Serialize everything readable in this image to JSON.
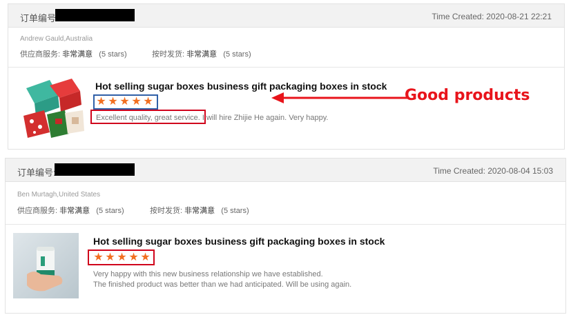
{
  "reviews": [
    {
      "order_label": "订单编号:",
      "time_created": "Time Created: 2020-08-21 22:21",
      "buyer": "Andrew Gauld,Australia",
      "supplier_service_label": "供应商服务:",
      "supplier_service_value": "非常满意",
      "supplier_service_stars": "(5 stars)",
      "on_time_label": "按时发货:",
      "on_time_value": "非常满意",
      "on_time_stars": "(5 stars)",
      "product_title": "Hot selling sugar boxes business gift packaging boxes in stock",
      "rating": 5,
      "review_lines": [
        "Excellent quality, great service. I will hire Zhijie He again. Very happy."
      ],
      "product_image_icon": "gift-boxes-photo"
    },
    {
      "order_label": "订单编号:",
      "time_created": "Time Created: 2020-08-04 15:03",
      "buyer": "Ben Murtagh,United States",
      "supplier_service_label": "供应商服务:",
      "supplier_service_value": "非常满意",
      "supplier_service_stars": "(5 stars)",
      "on_time_label": "按时发货:",
      "on_time_value": "非常满意",
      "on_time_stars": "(5 stars)",
      "product_title": "Hot selling sugar boxes business gift packaging boxes in stock",
      "rating": 5,
      "review_lines": [
        "Very happy with this new business relationship we have established.",
        "The finished product was better than we had anticipated. Will be using again."
      ],
      "product_image_icon": "tube-can-photo"
    }
  ],
  "annotation": {
    "text": "Good products",
    "color": "#e8141b"
  },
  "colors": {
    "star": "#f26f21",
    "highlight_red": "#d0021b",
    "highlight_blue": "#2f5fa7"
  }
}
